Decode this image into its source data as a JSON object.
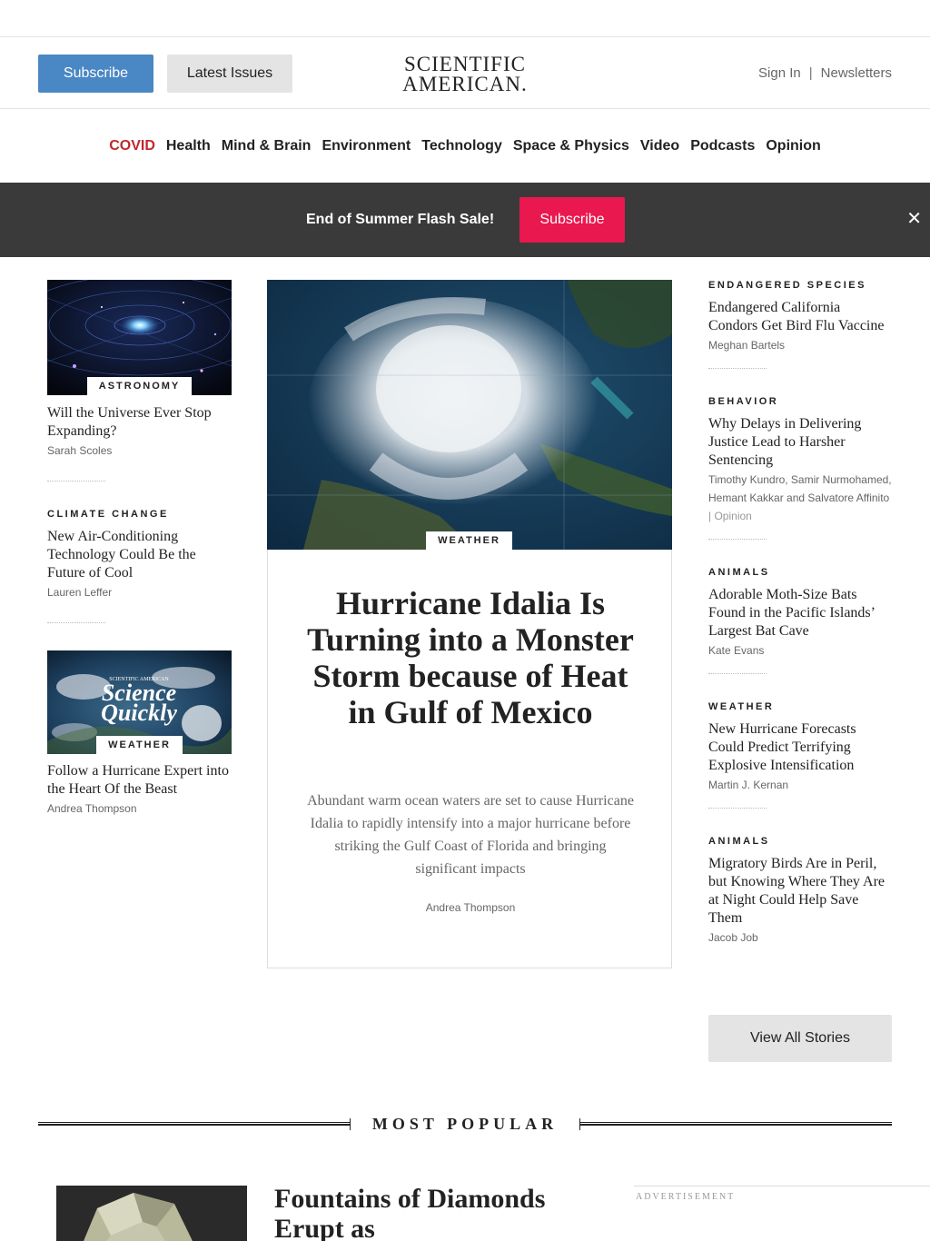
{
  "header": {
    "subscribe_label": "Subscribe",
    "latest_issues_label": "Latest Issues",
    "logo_line1": "SCIENTIFIC",
    "logo_line2": "AMERICAN.",
    "sign_in": "Sign In",
    "separator": "|",
    "newsletters": "Newsletters"
  },
  "nav": [
    {
      "label": "COVID",
      "highlight": "#c0282d"
    },
    {
      "label": "Health"
    },
    {
      "label": "Mind & Brain"
    },
    {
      "label": "Environment"
    },
    {
      "label": "Technology"
    },
    {
      "label": "Space & Physics"
    },
    {
      "label": "Video"
    },
    {
      "label": "Podcasts"
    },
    {
      "label": "Opinion"
    }
  ],
  "promo": {
    "text": "End of Summer Flash Sale!",
    "button_label": "Subscribe",
    "close_glyph": "✕",
    "bg_color": "#3a3a3a",
    "button_color": "#e9184f"
  },
  "left_stories": [
    {
      "kicker": "ASTRONOMY",
      "headline": "Will the Universe Ever Stop Expanding?",
      "byline": "Sarah Scoles",
      "image": "galaxy-illustration"
    },
    {
      "kicker": "CLIMATE CHANGE",
      "headline": "New Air-Conditioning Technology Could Be the Future of Cool",
      "byline": "Lauren Leffer"
    },
    {
      "kicker": "WEATHER",
      "headline": "Follow a Hurricane Expert into the Heart Of the Beast",
      "byline": "Andrea Thompson",
      "image": "science-quickly-earth",
      "image_text_small": "SCIENTIFIC AMERICAN",
      "image_text_1": "Science",
      "image_text_2": "Quickly"
    }
  ],
  "featured": {
    "kicker": "WEATHER",
    "headline": "Hurricane Idalia Is Turning into a Monster Storm because of Heat in Gulf of Mexico",
    "dek": "Abundant warm ocean waters are set to cause Hurricane Idalia to rapidly intensify into a major hurricane before striking the Gulf Coast of Florida and bringing significant impacts",
    "byline": "Andrea Thompson",
    "image": "hurricane-satellite"
  },
  "right_stories": [
    {
      "kicker": "ENDANGERED SPECIES",
      "headline": "Endangered California Condors Get Bird Flu Vaccine",
      "byline": "Meghan Bartels"
    },
    {
      "kicker": "BEHAVIOR",
      "headline": "Why Delays in Delivering Justice Lead to Harsher Sentencing",
      "byline": "Timothy Kundro, Samir Nurmohamed, Hemant Kakkar and Salvatore Affinito",
      "byline_sep": "|",
      "byline_tag": "Opinion"
    },
    {
      "kicker": "ANIMALS",
      "headline": "Adorable Moth-Size Bats Found in the Pacific Islands’ Largest Bat Cave",
      "byline": "Kate Evans"
    },
    {
      "kicker": "WEATHER",
      "headline": "New Hurricane Forecasts Could Predict Terrifying Explosive Intensification",
      "byline": "Martin J. Kernan"
    },
    {
      "kicker": "ANIMALS",
      "headline": "Migratory Birds Are in Peril, but Knowing Where They Are at Night Could Help Save Them",
      "byline": "Jacob Job"
    }
  ],
  "view_all_label": "View All Stories",
  "most_popular": {
    "title": "MOST POPULAR",
    "first_headline": "Fountains of Diamonds Erupt as",
    "first_image": "rough-diamond"
  },
  "advertisement_label": "ADVERTISEMENT",
  "colors": {
    "subscribe_blue": "#4a87c5",
    "covid_red": "#c0282d"
  }
}
